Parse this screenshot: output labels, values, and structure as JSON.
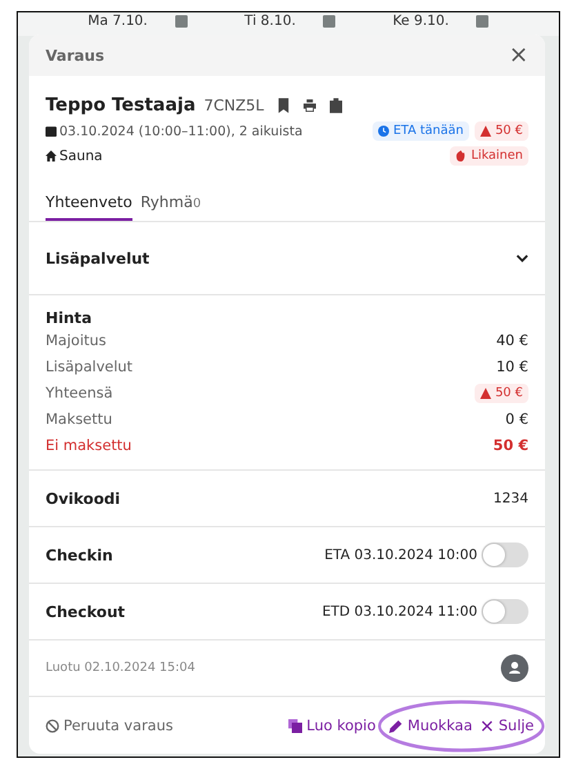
{
  "calendar": {
    "days": [
      {
        "label": "Ma 7.10."
      },
      {
        "label": "Ti 8.10."
      },
      {
        "label": "Ke 9.10."
      }
    ]
  },
  "dialog": {
    "title": "Varaus",
    "close": "×",
    "guest": {
      "name": "Teppo Testaaja",
      "code": "7CNZ5L",
      "dates": "03.10.2024 (10:00–11:00), 2 aikuista",
      "unit": "Sauna"
    },
    "badges": [
      {
        "text": "ETA tänään",
        "kind": "info"
      },
      {
        "text": "50 €",
        "kind": "warning"
      },
      {
        "text": "Likainen",
        "kind": "dirty"
      }
    ],
    "tabs": [
      {
        "label": "Yhteenveto",
        "selected": true
      },
      {
        "label": "Ryhmä",
        "count": "0",
        "selected": false
      }
    ],
    "extras": {
      "title": "Lisäpalvelut",
      "expanded": false
    },
    "price": {
      "title": "Hinta",
      "rows": [
        {
          "label": "Majoitus",
          "value": "40 €",
          "kind": "normal"
        },
        {
          "label": "Lisäpalvelut",
          "value": "10 €",
          "kind": "normal"
        },
        {
          "label": "Yhteensä",
          "value": "50 €",
          "kind": "warning"
        },
        {
          "label": "Maksettu",
          "value": "0 €",
          "kind": "normal"
        },
        {
          "label": "Ei maksettu",
          "value": "50 €",
          "kind": "due"
        }
      ]
    },
    "door_code": {
      "label": "Ovikoodi",
      "value": "1234"
    },
    "checks": [
      {
        "label": "Checkin",
        "time": "ETA 03.10.2024 10:00",
        "on": false
      },
      {
        "label": "Checkout",
        "time": "ETD 03.10.2024 11:00",
        "on": false
      }
    ],
    "created": "Luotu 02.10.2024 15:04",
    "footer": {
      "cancel": "Peruuta varaus",
      "copy": "Luo kopio",
      "edit": "Muokkaa",
      "close": "Sulje"
    }
  }
}
